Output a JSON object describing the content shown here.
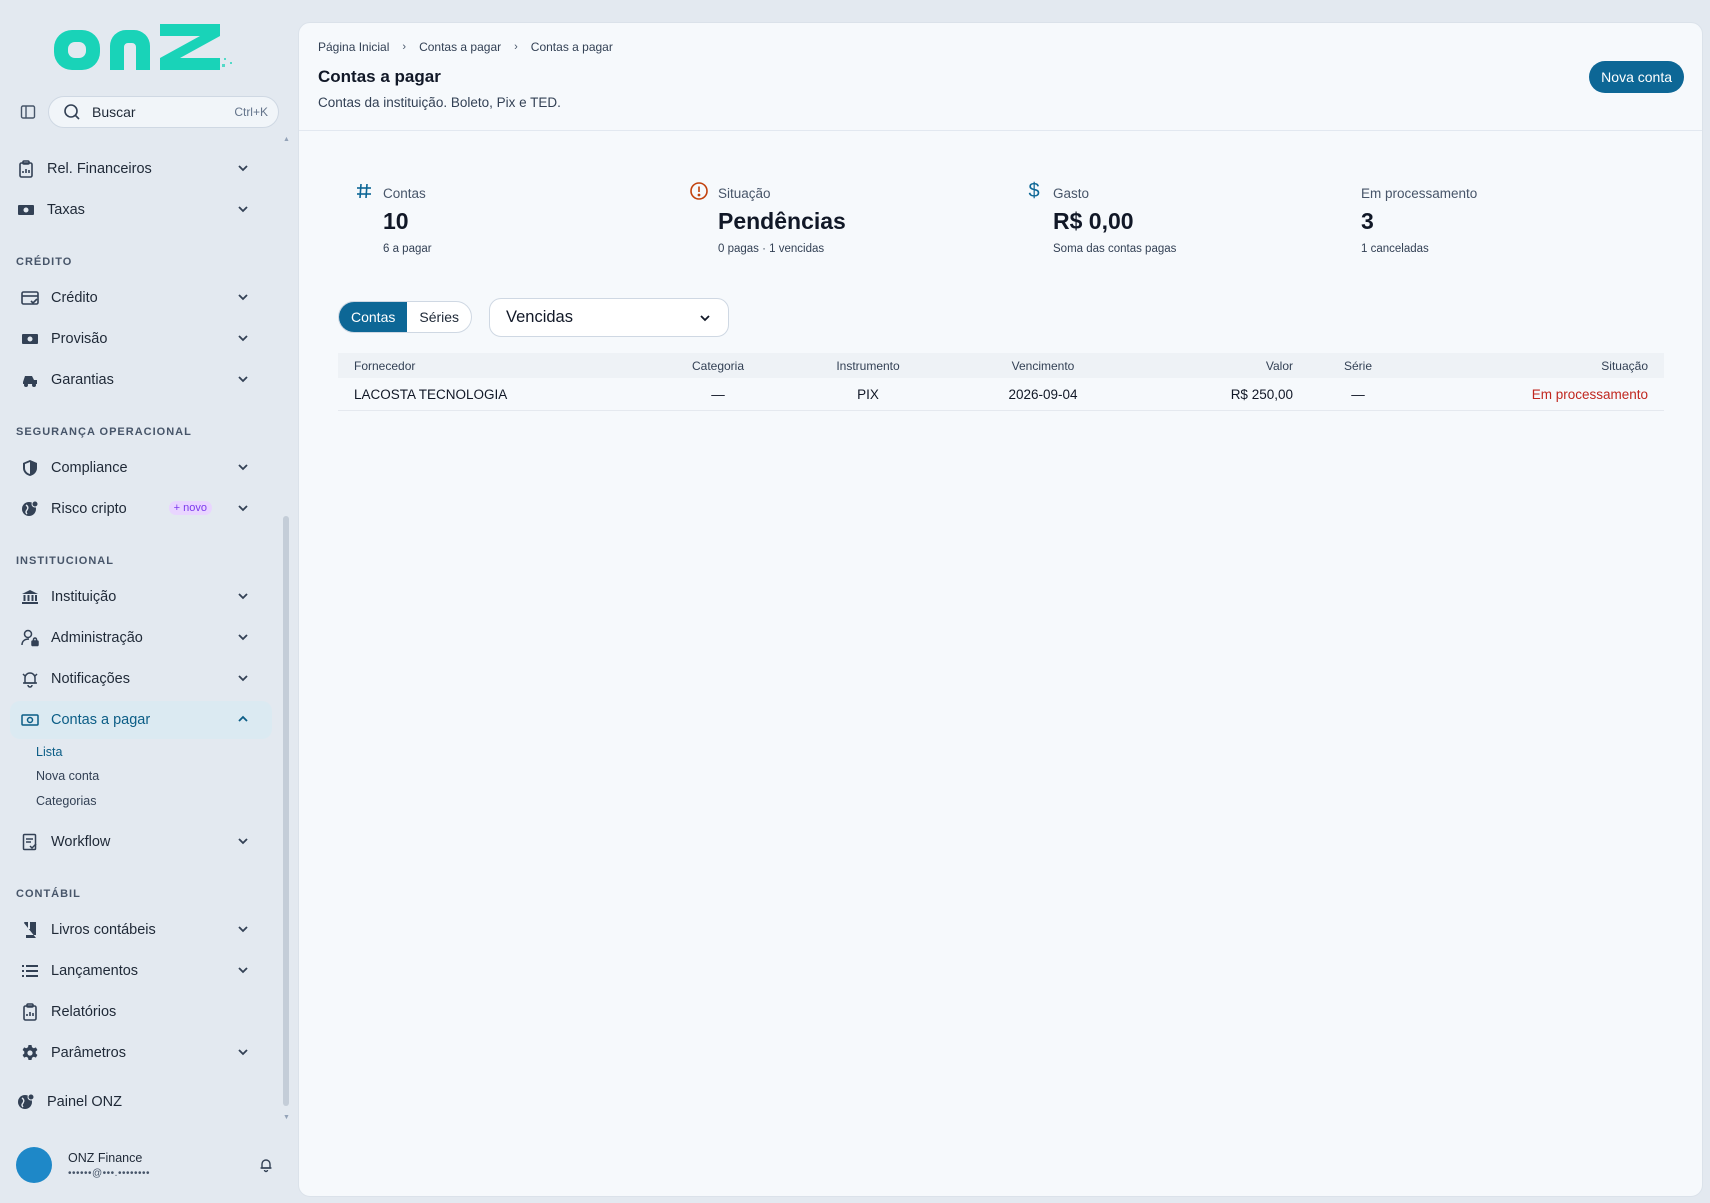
{
  "brand": {
    "logo_text": "onz"
  },
  "search": {
    "placeholder": "Buscar",
    "shortcut": "Ctrl+K"
  },
  "sidebar": {
    "items_top": [
      {
        "label": "Rel. Financeiros",
        "icon": "clipboard-chart-icon"
      },
      {
        "label": "Taxas",
        "icon": "money-icon"
      }
    ],
    "sections": [
      {
        "title": "CRÉDITO",
        "items": [
          {
            "label": "Crédito",
            "icon": "card-check-icon"
          },
          {
            "label": "Provisão",
            "icon": "money-icon"
          },
          {
            "label": "Garantias",
            "icon": "car-icon"
          }
        ]
      },
      {
        "title": "SEGURANÇA OPERACIONAL",
        "items": [
          {
            "label": "Compliance",
            "icon": "shield-icon"
          },
          {
            "label": "Risco cripto",
            "icon": "globe-icon",
            "badge": "+ novo"
          }
        ]
      },
      {
        "title": "INSTITUCIONAL",
        "items": [
          {
            "label": "Instituição",
            "icon": "bank-icon"
          },
          {
            "label": "Administração",
            "icon": "user-lock-icon"
          },
          {
            "label": "Notificações",
            "icon": "bell-icon"
          },
          {
            "label": "Contas a pagar",
            "icon": "money-icon"
          }
        ]
      },
      {
        "title": "CONTÁBIL",
        "items": [
          {
            "label": "Livros contábeis",
            "icon": "book-icon"
          },
          {
            "label": "Lançamentos",
            "icon": "list-icon"
          },
          {
            "label": "Relatórios",
            "icon": "clipboard-icon"
          },
          {
            "label": "Parâmetros",
            "icon": "gear-icon"
          }
        ]
      }
    ],
    "contas_sub": [
      "Lista",
      "Nova conta",
      "Categorias"
    ],
    "workflow": "Workflow",
    "painel": "Painel ONZ"
  },
  "user": {
    "name": "ONZ Finance",
    "email": "••••••@•••.••••••••"
  },
  "header": {
    "breadcrumb": [
      "Página Inicial",
      "Contas a pagar",
      "Contas a pagar"
    ],
    "title": "Contas a pagar",
    "subtitle": "Contas da instituição. Boleto, Pix e TED.",
    "new_button": "Nova conta"
  },
  "stats": [
    {
      "icon": "hash-icon",
      "label": "Contas",
      "value": "10",
      "note": "6 a pagar"
    },
    {
      "icon": "alert-circle-icon",
      "label": "Situação",
      "value": "Pendências",
      "note": "0 pagas · 1 vencidas"
    },
    {
      "icon": "dollar-icon",
      "label": "Gasto",
      "value": "R$ 0,00",
      "note": "Soma das contas pagas"
    },
    {
      "icon": "",
      "label": "Em processamento",
      "value": "3",
      "note": "1 canceladas"
    }
  ],
  "tabs": {
    "contas": "Contas",
    "series": "Séries"
  },
  "filter": {
    "selected": "Vencidas"
  },
  "table": {
    "headers": [
      "Fornecedor",
      "Categoria",
      "Instrumento",
      "Vencimento",
      "Valor",
      "Série",
      "Situação"
    ],
    "rows": [
      [
        "LACOSTA TECNOLOGIA",
        "—",
        "PIX",
        "2026-09-04",
        "R$ 250,00",
        "—",
        "Em processamento"
      ]
    ]
  },
  "colors": {
    "brand": "#19d3b8",
    "primary": "#0d6796",
    "danger": "#c0271f",
    "alert": "#c2410c"
  }
}
